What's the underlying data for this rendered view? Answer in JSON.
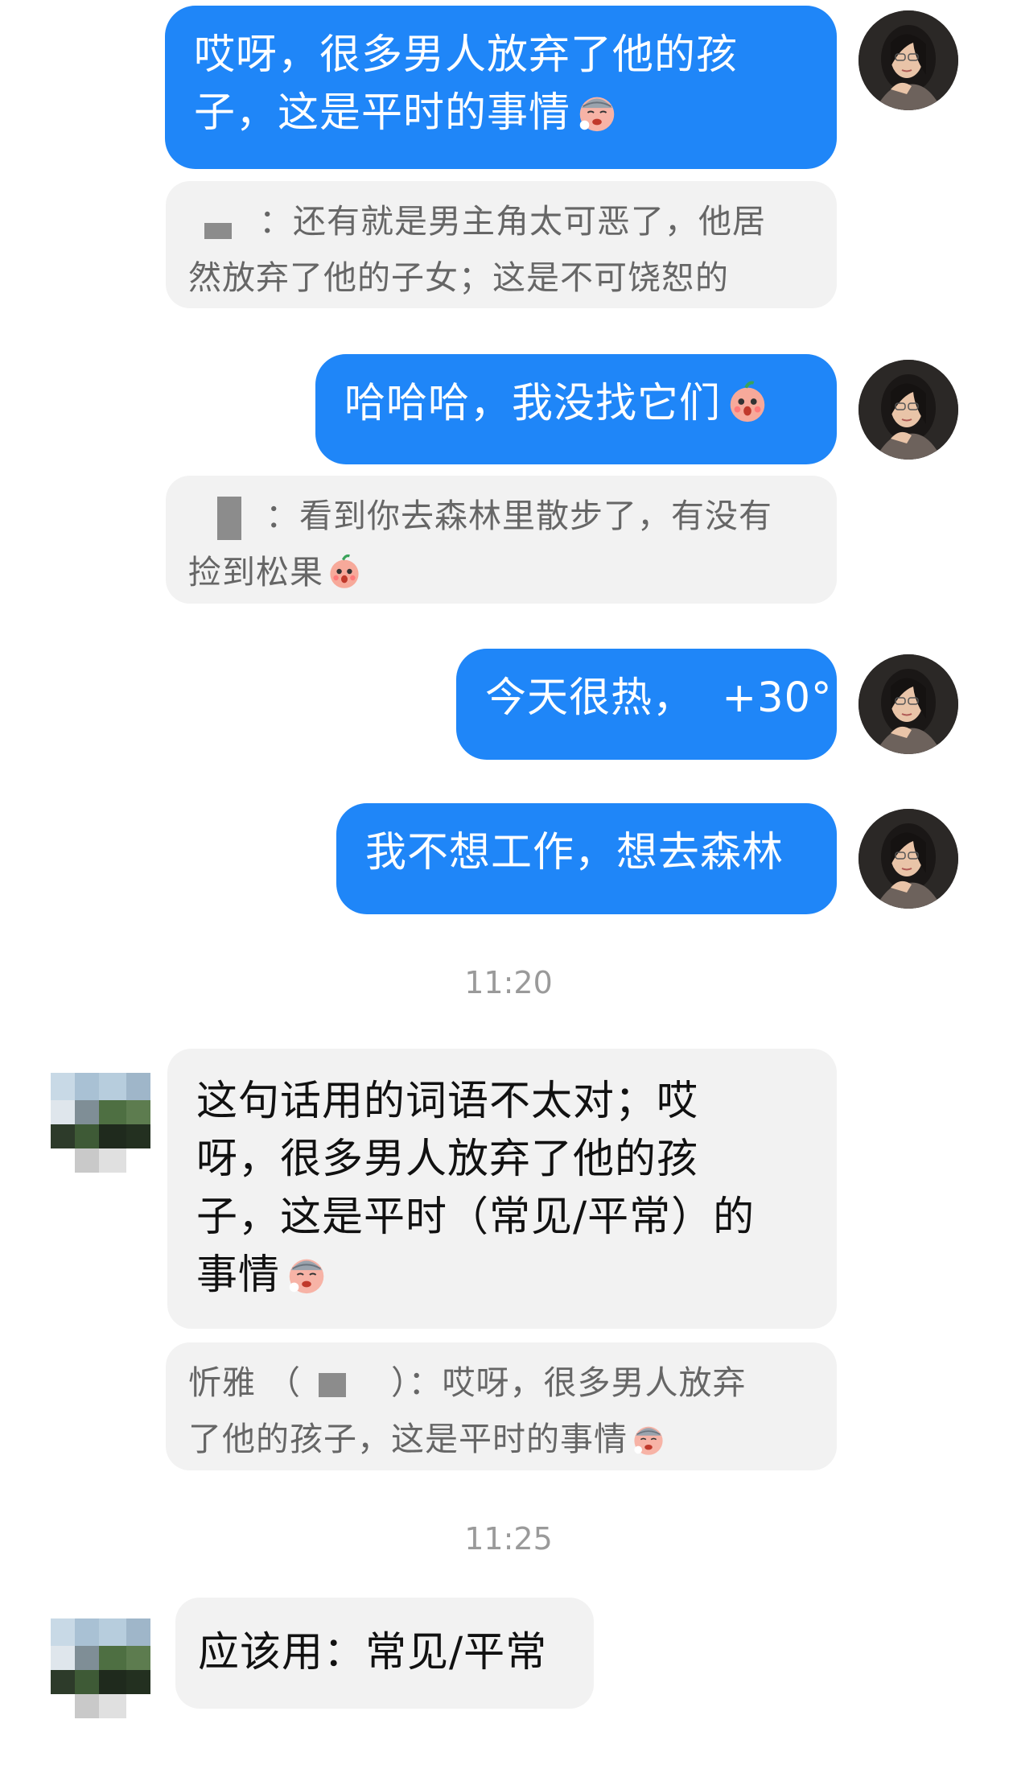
{
  "messages": {
    "m1": {
      "line1": "哎呀，很多男人放弃了他的孩",
      "line2": "子，这是平时的事情",
      "emoji": "sick-face-emoji"
    },
    "q1": {
      "sep": "：",
      "line1": "还有就是男主角太可恶了，他居",
      "line2": "然放弃了他的子女；这是不可饶恕的"
    },
    "m2": {
      "text": "哈哈哈，我没找它们",
      "emoji": "shy-face-emoji"
    },
    "q2": {
      "sep": "：",
      "line1": "看到你去森林里散步了，有没有",
      "line2": "捡到松果",
      "emoji": "shy-face-emoji"
    },
    "m3": {
      "text": "今天很热，  +30°"
    },
    "m4": {
      "text": "我不想工作，想去森林"
    },
    "t1": "11:20",
    "m5": {
      "line1": "这句话用的词语不太对；哎",
      "line2": "呀，很多男人放弃了他的孩",
      "line3": "子，这是平时（常见/平常）的",
      "line4": "事情",
      "emoji": "sick-face-emoji"
    },
    "q3": {
      "name": "忻雅",
      "open": "（",
      "close": "）",
      "sep": "：",
      "line1": "哎呀，很多男人放弃",
      "line2": "了他的孩子，这是平时的事情",
      "emoji": "sick-face-emoji"
    },
    "t2": "11:25",
    "m6": {
      "text": "应该用：常见/平常"
    }
  },
  "colors": {
    "outgoing_bubble": "#1f86f8",
    "incoming_bubble": "#f2f2f2",
    "timestamp": "#9a9a9a"
  }
}
